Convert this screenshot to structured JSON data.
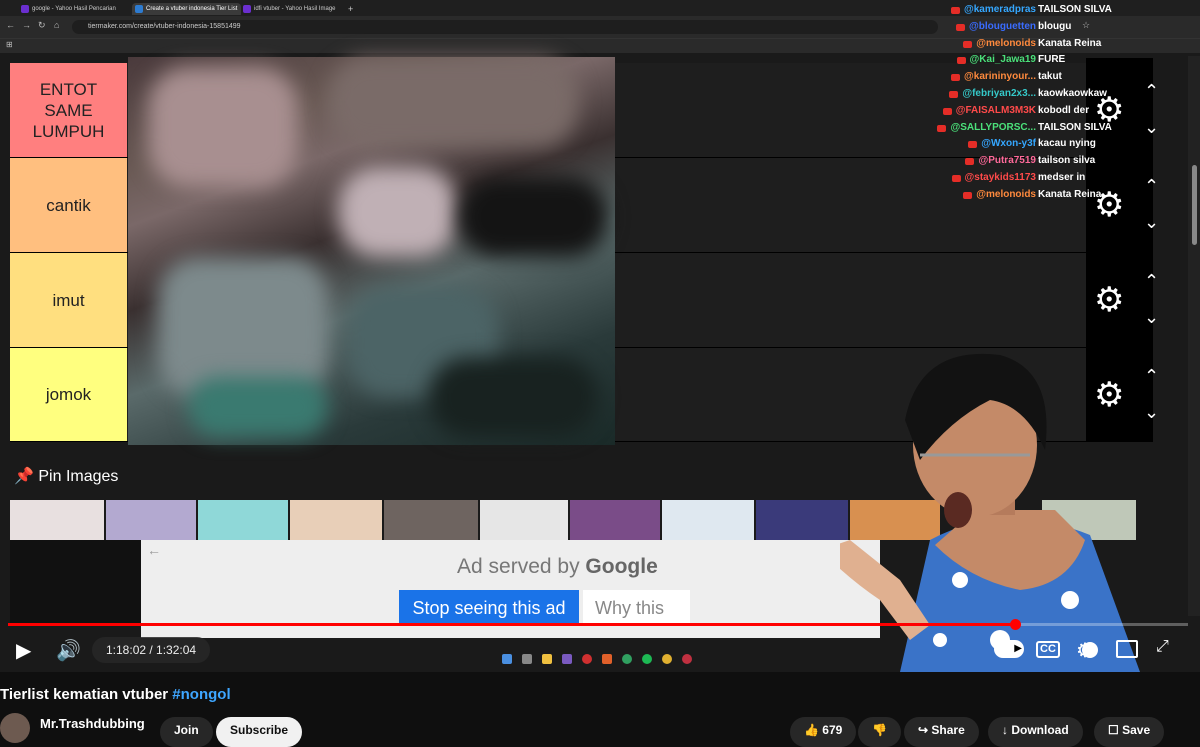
{
  "browser": {
    "tabs": [
      {
        "label": "google - Yahoo Hasil Pencarian",
        "active": false
      },
      {
        "label": "Create a vtuber indonesia Tier List",
        "active": true
      },
      {
        "label": "idfi vtuber - Yahoo Hasil Image",
        "active": false
      }
    ],
    "new_tab": "+",
    "url": "tiermaker.com/create/vtuber-indonesia-15851499"
  },
  "tiers": [
    {
      "label": "ENTOT SAME LUMPUH",
      "color": "#ff7f7f"
    },
    {
      "label": "cantik",
      "color": "#ffbf7f"
    },
    {
      "label": "imut",
      "color": "#ffdf7f"
    },
    {
      "label": "jomok",
      "color": "#ffff7f"
    }
  ],
  "pin_images": {
    "label": "Pin Images"
  },
  "ad": {
    "served_by": "Ad served by",
    "brand": "Google",
    "stop_label": "Stop seeing this ad",
    "why_label": "Why this"
  },
  "chat": [
    {
      "user": "@kameradpras",
      "message": "TAILSON SILVA",
      "color": "#35a7ff"
    },
    {
      "user": "@blouguetten",
      "message": "blougu",
      "color": "#3a6cff"
    },
    {
      "user": "@melonoids",
      "message": "Kanata Reina",
      "color": "#ff8a3d"
    },
    {
      "user": "@Kai_Jawa19",
      "message": "FURE",
      "color": "#4be07a"
    },
    {
      "user": "@karininyour...",
      "message": "takut",
      "color": "#ff8a3d"
    },
    {
      "user": "@febriyan2x3...",
      "message": "kaowkaowkaw",
      "color": "#35c9c9"
    },
    {
      "user": "@FAISALM3M3K",
      "message": "kobodl der",
      "color": "#ff4a4a"
    },
    {
      "user": "@SALLYPORSC...",
      "message": "TAILSON SILVA",
      "color": "#4be07a"
    },
    {
      "user": "@Wxon-y3f",
      "message": "kacau nying",
      "color": "#35a7ff"
    },
    {
      "user": "@Putra7519",
      "message": "tailson silva",
      "color": "#ff6a9a"
    },
    {
      "user": "@staykids1173",
      "message": "medser in",
      "color": "#ff4a4a"
    },
    {
      "user": "@melonoids",
      "message": "Kanata Reina",
      "color": "#ff8a3d"
    }
  ],
  "player": {
    "time": "1:18:02 / 1:32:04",
    "progress": 0.853,
    "accent": "#ff0000"
  },
  "video": {
    "title": "Tierlist kematian vtuber",
    "hashtag": "#nongol",
    "channel": "Mr.Trashdubbing",
    "join_label": "Join",
    "subscribe_label": "Subscribe",
    "likes": "679",
    "share_label": "Share",
    "download_label": "Download",
    "save_label": "Save"
  }
}
